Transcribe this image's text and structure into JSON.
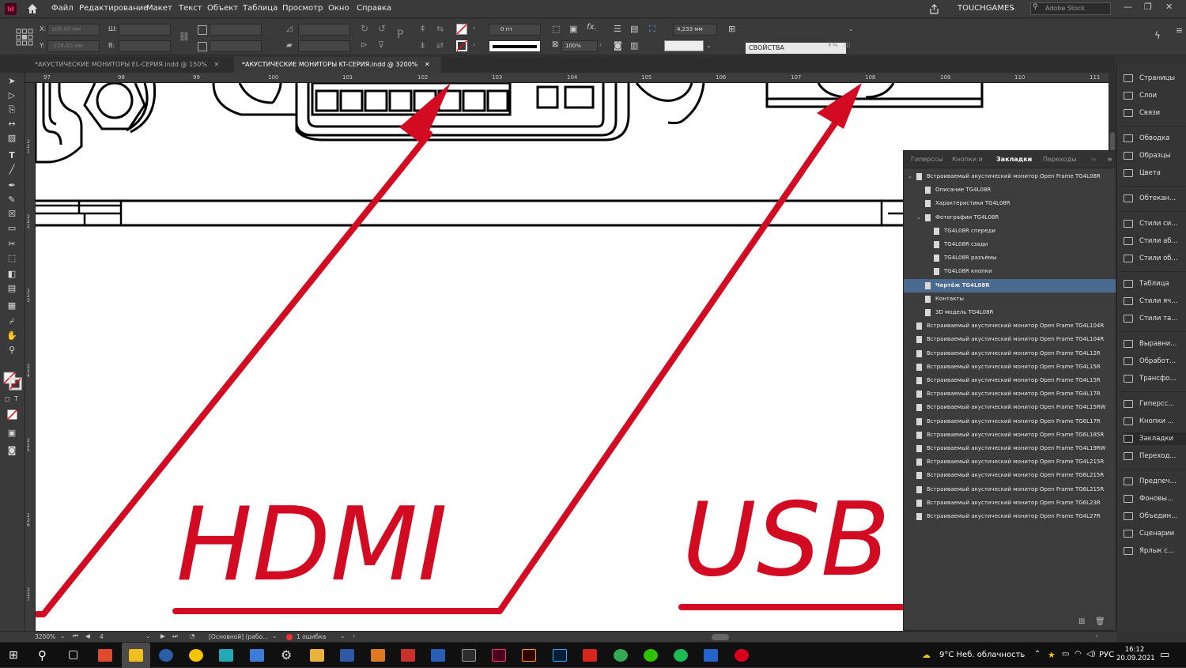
{
  "app": {
    "logo_label": "Id"
  },
  "menu": [
    "Файл",
    "Редактирование",
    "Макет",
    "Текст",
    "Объект",
    "Таблица",
    "Просмотр",
    "Окно",
    "Справка"
  ],
  "top_right": {
    "workspace": "TOUCHGAMES",
    "search_placeholder": "Adobe Stock"
  },
  "control": {
    "x_label": "X:",
    "x_value": "106,45 мм",
    "y_label": "Y:",
    "y_value": "-226,65 мм",
    "w_label": "Ш:",
    "h_label": "В:",
    "stroke_weight": "0 пт",
    "opacity": "100%",
    "gap_value": "4,233 мм",
    "style_value": "СВОЙСТВА"
  },
  "tabs": [
    {
      "label": "*АКУСТИЧЕСКИЕ МОНИТОРЫ EL-СЕРИЯ.indd @ 150%",
      "active": false
    },
    {
      "label": "*АКУСТИЧЕСКИЕ МОНИТОРЫ KT-СЕРИЯ.indd @ 3200%",
      "active": true
    }
  ],
  "ruler": {
    "h_ticks": [
      "97",
      "98",
      "99",
      "100",
      "101",
      "102",
      "103",
      "104",
      "105",
      "106",
      "107",
      "108",
      "109",
      "110",
      "111"
    ],
    "v_ticks": [
      "2 2 1",
      "2 2 2",
      "2 2 3",
      "2 2 4",
      "2 2 5",
      "2 2 6",
      "2 2 7"
    ]
  },
  "canvas_text": {
    "label1": "HDMI",
    "label2": "USB"
  },
  "colors": {
    "accent": "#d20a22",
    "selection": "#4b6a8f"
  },
  "panel_strip": [
    "Страницы",
    "Слои",
    "Связи",
    "Обводка",
    "Образцы",
    "Цвета",
    "Обтекан...",
    "Стили си...",
    "Стили аб...",
    "Стили об...",
    "Таблица",
    "Стили яч...",
    "Стили та...",
    "Выравни...",
    "Обработ...",
    "Трансфо...",
    "Гиперсс...",
    "Кнопки ...",
    "Закладки",
    "Переход...",
    "Предпеч...",
    "Фоновы...",
    "Объедин...",
    "Сценарии",
    "Ярлык с..."
  ],
  "bookmarks_panel": {
    "tabs": [
      "Гиперссы",
      "Кнопки и",
      "Закладки",
      "Переходы"
    ],
    "rows": [
      {
        "label": "Встраиваемый акустический монитор Open Frame TG4L08R",
        "level": 0,
        "expanded": true,
        "selected": false
      },
      {
        "label": "Описание TG4L08R",
        "level": 1,
        "expanded": false,
        "selected": false
      },
      {
        "label": "Характеристики TG4L08R",
        "level": 1,
        "expanded": false,
        "selected": false
      },
      {
        "label": "Фотографии TG4L08R",
        "level": 1,
        "expanded": true,
        "selected": false
      },
      {
        "label": "TG4L08R спереди",
        "level": 2,
        "expanded": false,
        "selected": false
      },
      {
        "label": "TG4L08R сзади",
        "level": 2,
        "expanded": false,
        "selected": false
      },
      {
        "label": "TG4L08R разъёмы",
        "level": 2,
        "expanded": false,
        "selected": false
      },
      {
        "label": "TG4L08R кнопки",
        "level": 2,
        "expanded": false,
        "selected": false
      },
      {
        "label": "Чертёж TG4L08R",
        "level": 1,
        "expanded": false,
        "selected": true
      },
      {
        "label": "Контакты",
        "level": 1,
        "expanded": false,
        "selected": false
      },
      {
        "label": "3D модель TG4L08R",
        "level": 1,
        "expanded": false,
        "selected": false
      },
      {
        "label": "Встраиваемый акустический монитор Open Frame TG4L104R",
        "level": 0,
        "expanded": false,
        "selected": false
      },
      {
        "label": "Встраиваемый акустический монитор Open Frame TG4L104R",
        "level": 0,
        "expanded": false,
        "selected": false
      },
      {
        "label": "Встраиваемый акустический монитор Open Frame TG4L12R",
        "level": 0,
        "expanded": false,
        "selected": false
      },
      {
        "label": "Встраиваемый акустический монитор Open Frame TG4L15R",
        "level": 0,
        "expanded": false,
        "selected": false
      },
      {
        "label": "Встраиваемый акустический монитор Open Frame TG4L15R",
        "level": 0,
        "expanded": false,
        "selected": false
      },
      {
        "label": "Встраиваемый акустический монитор Open Frame TG4L17R",
        "level": 0,
        "expanded": false,
        "selected": false
      },
      {
        "label": "Встраиваемый акустический монитор Open Frame TG4L15RW",
        "level": 0,
        "expanded": false,
        "selected": false
      },
      {
        "label": "Встраиваемый акустический монитор Open Frame TG6L17R",
        "level": 0,
        "expanded": false,
        "selected": false
      },
      {
        "label": "Встраиваемый акустический монитор Open Frame TG6L185R",
        "level": 0,
        "expanded": false,
        "selected": false
      },
      {
        "label": "Встраиваемый акустический монитор Open Frame TG4L19RW",
        "level": 0,
        "expanded": false,
        "selected": false
      },
      {
        "label": "Встраиваемый акустический монитор Open Frame TG4L215R",
        "level": 0,
        "expanded": false,
        "selected": false
      },
      {
        "label": "Встраиваемый акустический монитор Open Frame TG6L215R",
        "level": 0,
        "expanded": false,
        "selected": false
      },
      {
        "label": "Встраиваемый акустический монитор Open Frame TG6L215R",
        "level": 0,
        "expanded": false,
        "selected": false
      },
      {
        "label": "Встраиваемый акустический монитор Open Frame TG6L23R",
        "level": 0,
        "expanded": false,
        "selected": false
      },
      {
        "label": "Встраиваемый акустический монитор Open Frame TG4L27R",
        "level": 0,
        "expanded": false,
        "selected": false
      }
    ]
  },
  "status": {
    "zoom": "3200%",
    "page": "4",
    "master": "[Основной] (рабо...",
    "errors": "1 ошибка"
  },
  "taskbar": {
    "weather": "9°C  Неб. облачность",
    "lang": "РУС",
    "time": "16:12",
    "date": "20.09.2021"
  }
}
